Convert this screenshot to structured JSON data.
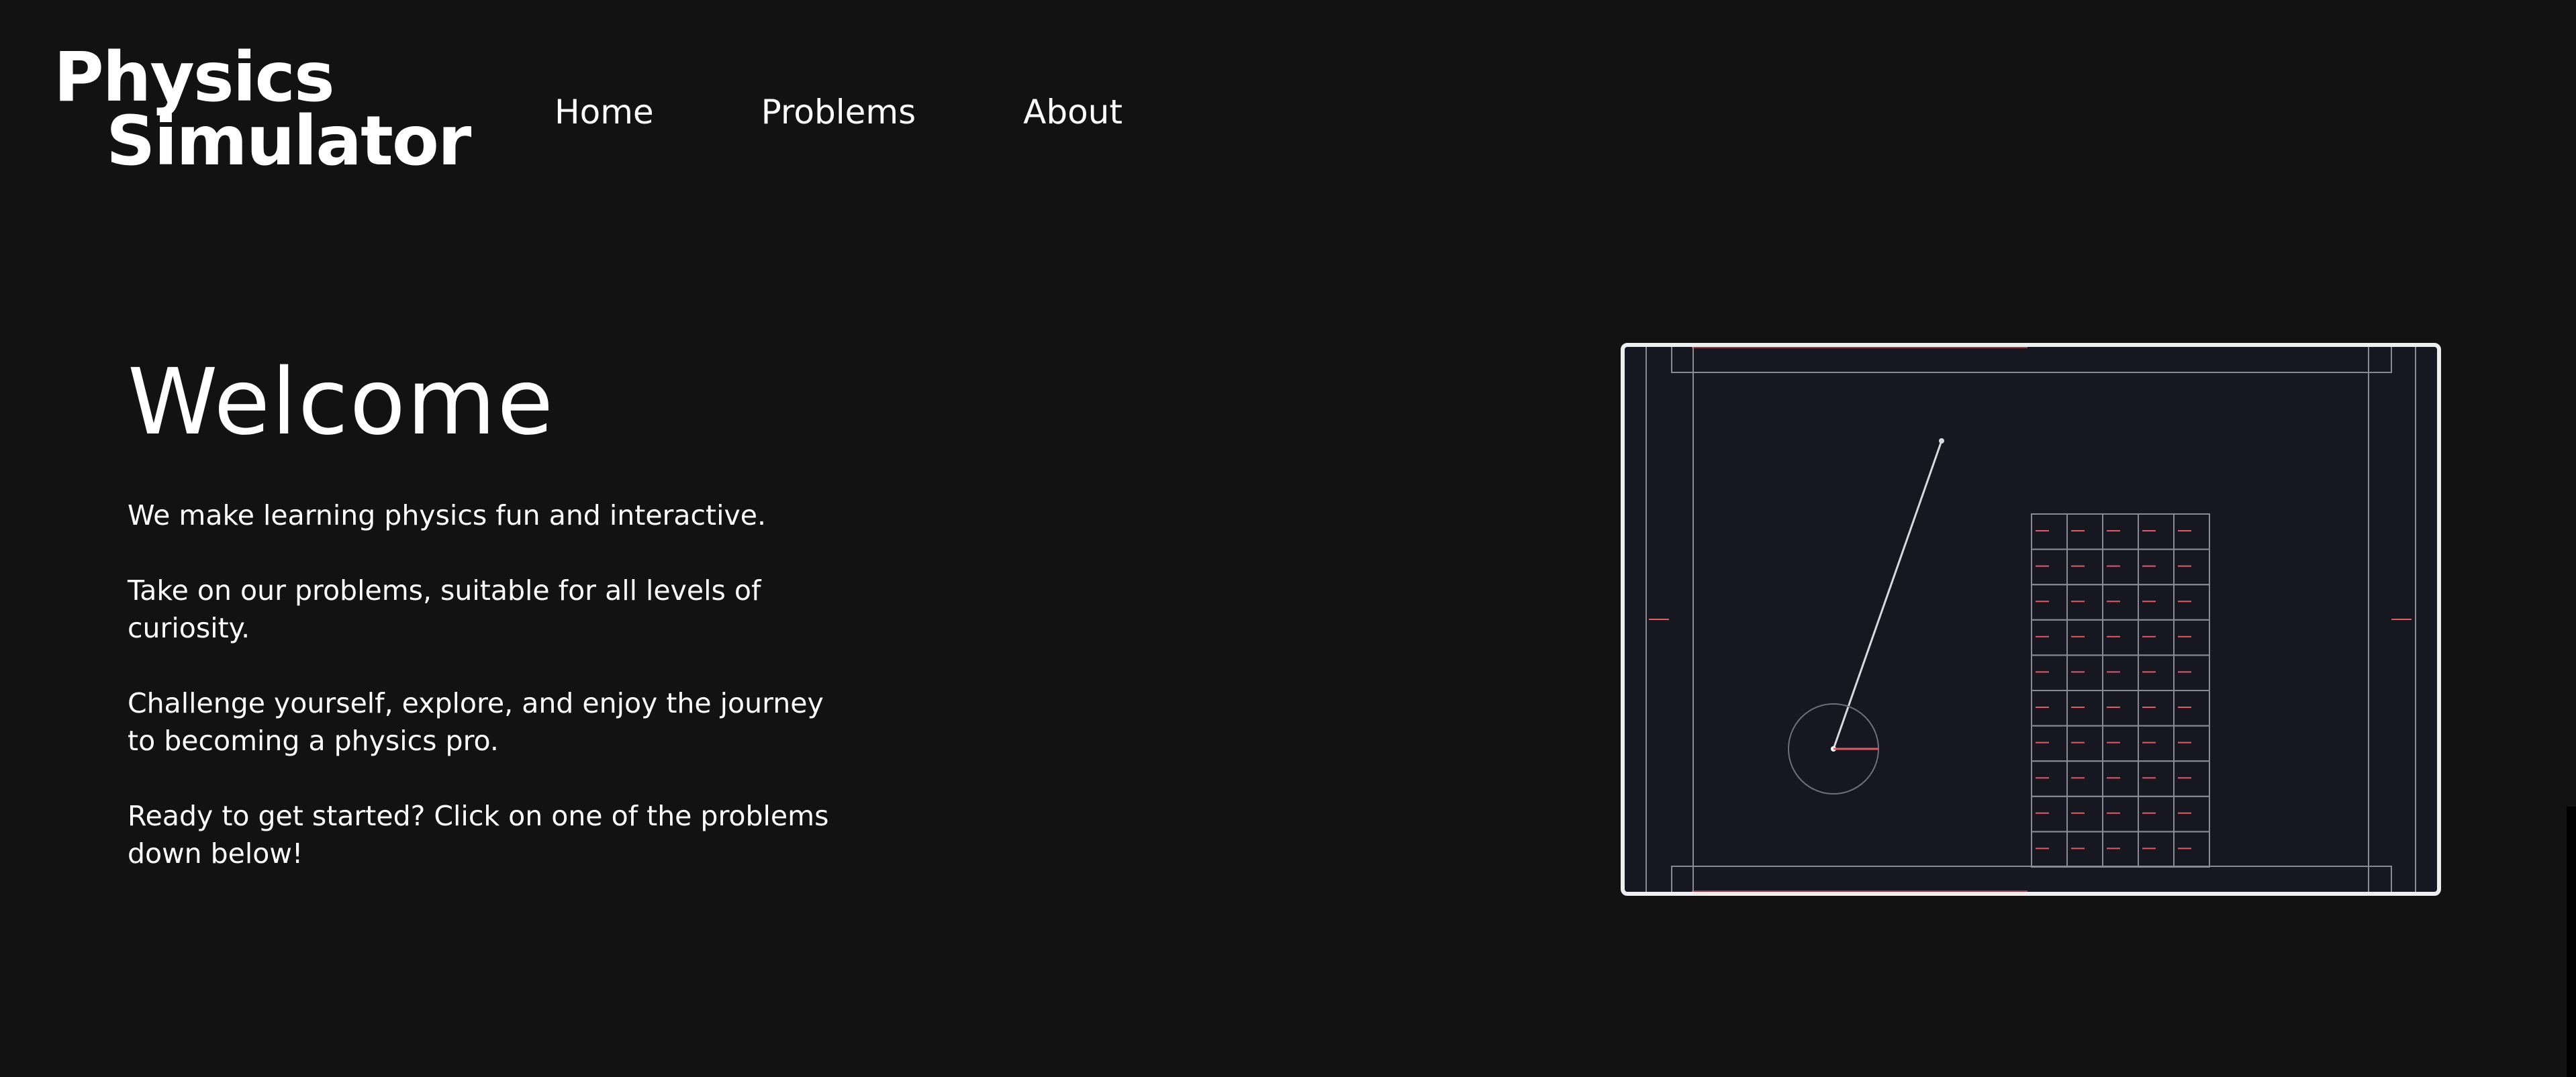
{
  "brand": {
    "line1": "Physics",
    "line2": "Simulator"
  },
  "nav": {
    "items": [
      {
        "label": "Home"
      },
      {
        "label": "Problems"
      },
      {
        "label": "About"
      }
    ]
  },
  "hero": {
    "title": "Welcome",
    "paragraphs": [
      "We make learning physics fun and interactive.",
      "Take on our problems, suitable for all levels of curiosity.",
      "Challenge yourself, explore, and enjoy the journey to becoming a physics pro.",
      "Ready to get started? Click on one of the problems down below!"
    ]
  },
  "colors": {
    "background": "#121212",
    "text": "#ffffff",
    "sim_background": "#171722",
    "sim_lines": "#8a8a95",
    "sim_accent": "#e05a64"
  }
}
